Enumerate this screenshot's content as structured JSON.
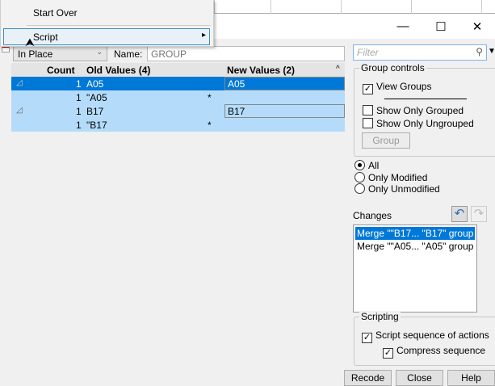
{
  "menu": {
    "items": [
      {
        "label": "Start Over"
      },
      {
        "label": "Script",
        "submenu_arrow": "▸"
      }
    ]
  },
  "window": {
    "minimize": "—",
    "maximize": "☐",
    "close": "✕"
  },
  "toolbar": {
    "mode": "In Place",
    "name_label": "Name:",
    "name_placeholder": "GROUP"
  },
  "table": {
    "headers": [
      "Count",
      "Old Values (4)",
      "",
      "New Values (2)"
    ],
    "rows": [
      {
        "count": "1",
        "old": "A05",
        "mod": "",
        "new": "A05",
        "group": true,
        "selected": true
      },
      {
        "count": "1",
        "old": "\"A05",
        "mod": "*",
        "new": ""
      },
      {
        "count": "1",
        "old": "B17",
        "mod": "",
        "new": "B17",
        "group": true
      },
      {
        "count": "1",
        "old": "\"B17",
        "mod": "*",
        "new": ""
      }
    ]
  },
  "filter": {
    "placeholder": "Filter"
  },
  "group_controls": {
    "title": "Group controls",
    "view_groups": "View Groups",
    "show_only_grouped": "Show Only Grouped",
    "show_only_ungrouped": "Show Only Ungrouped",
    "group_button": "Group"
  },
  "view_filter": {
    "options": [
      "All",
      "Only Modified",
      "Only Unmodified"
    ],
    "selected": "All"
  },
  "changes": {
    "label": "Changes",
    "items": [
      "Merge \"\"B17... \"B17\" group",
      "Merge \"\"A05... \"A05\" group"
    ]
  },
  "scripting": {
    "title": "Scripting",
    "script_sequence": "Script sequence of actions",
    "compress": "Compress sequence"
  },
  "buttons": {
    "recode": "Recode",
    "close": "Close",
    "help": "Help"
  },
  "colors": {
    "selection": "#0078d7",
    "light_selection": "#b4dcfa"
  }
}
